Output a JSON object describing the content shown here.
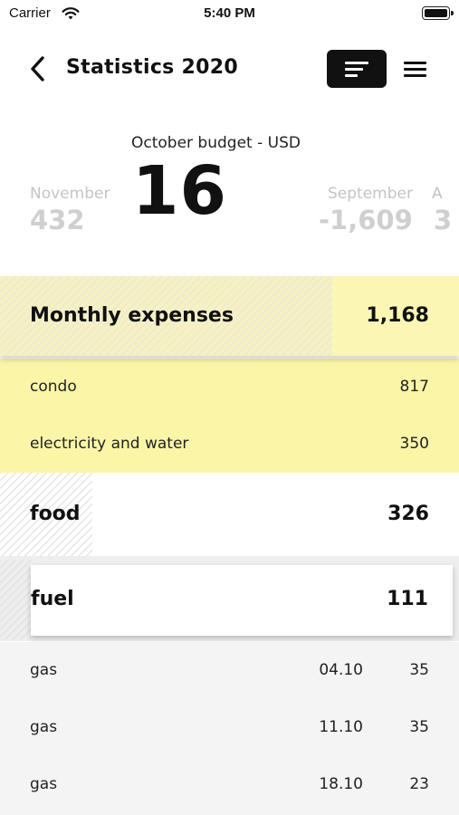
{
  "status_bar": {
    "carrier": "Carrier",
    "time": "5:40 PM",
    "wifi_icon": "wifi-icon",
    "battery_icon": "battery-icon"
  },
  "nav": {
    "title": "Statistics 2020",
    "back_icon": "chevron-left-icon",
    "sort_icon": "sort-icon",
    "menu_icon": "hamburger-menu-icon"
  },
  "budget": {
    "label": "October budget - USD",
    "value": "16",
    "prev_month": "November",
    "prev_value": "432",
    "next_month": "September",
    "next_value": "-1,609",
    "partial_month": "A",
    "partial_value": "3"
  },
  "categories": [
    {
      "name": "Monthly expenses",
      "amount": "1,168",
      "items": [
        {
          "name": "condo",
          "amount": "817"
        },
        {
          "name": "electricity and water",
          "amount": "350"
        }
      ]
    },
    {
      "name": "food",
      "amount": "326",
      "items": []
    },
    {
      "name": "fuel",
      "amount": "111",
      "items": [
        {
          "name": "gas",
          "date": "04.10",
          "amount": "35"
        },
        {
          "name": "gas",
          "date": "11.10",
          "amount": "35"
        },
        {
          "name": "gas",
          "date": "18.10",
          "amount": "23"
        }
      ]
    }
  ],
  "colors": {
    "highlight_yellow": "#fbf5a8",
    "accent_black": "#111111",
    "muted_grey": "#cfcfcf"
  }
}
